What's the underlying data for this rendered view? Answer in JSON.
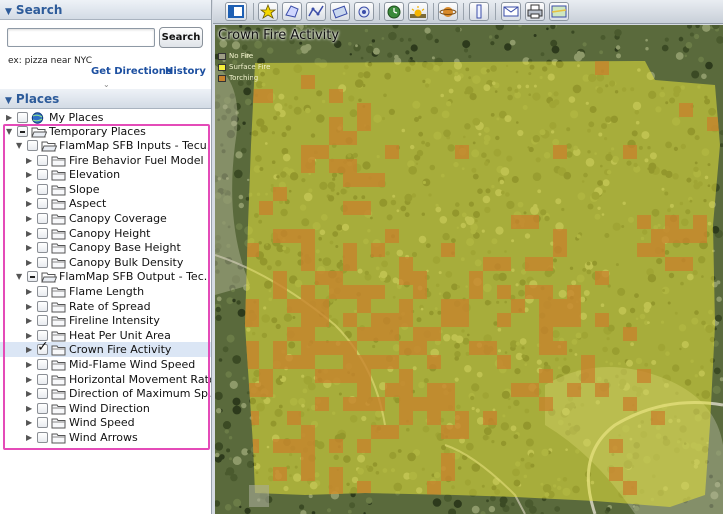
{
  "search": {
    "header": "Search",
    "input_value": "",
    "button_label": "Search",
    "example_text": "ex: pizza near NYC",
    "get_directions_label": "Get Directions",
    "history_label": "History"
  },
  "places": {
    "header": "Places",
    "my_places": "My Places",
    "temporary_places": "Temporary Places",
    "inputs_folder": "FlamMap SFB Inputs - Tecu...",
    "inputs": [
      "Fire Behavior Fuel Model",
      "Elevation",
      "Slope",
      "Aspect",
      "Canopy Coverage",
      "Canopy Height",
      "Canopy Base Height",
      "Canopy Bulk Density"
    ],
    "outputs_folder": "FlamMap SFB Output - Tec...",
    "outputs": [
      "Flame Length",
      "Rate of Spread",
      "Fireline Intensity",
      "Heat Per Unit Area",
      "Crown Fire Activity",
      "Mid-Flame Wind Speed",
      "Horizontal Movement Rate",
      "Direction of Maximum Sp...",
      "Wind Direction",
      "Wind Speed",
      "Wind Arrows"
    ],
    "checked_output": "Crown Fire Activity"
  },
  "toolbar": {
    "icons": [
      "sidebar-toggle-icon",
      "placemark-icon",
      "polygon-icon",
      "path-icon",
      "image-overlay-icon",
      "record-tour-icon",
      "historical-imagery-icon",
      "sunlight-icon",
      "planets-icon",
      "ruler-icon",
      "email-icon",
      "print-icon",
      "view-in-maps-icon"
    ]
  },
  "map": {
    "title": "Crown Fire Activity",
    "legend": [
      {
        "label": "No Fire",
        "color": "#9e9e86"
      },
      {
        "label": "Surface Fire",
        "color": "#f2ee3a"
      },
      {
        "label": "Torching",
        "color": "#c8822c"
      }
    ]
  },
  "colors": {
    "accent_blue": "#2d5b9a",
    "outline_pink": "#e44bb8",
    "surface_fire": "#e8e43a",
    "torching": "#c8822c"
  }
}
